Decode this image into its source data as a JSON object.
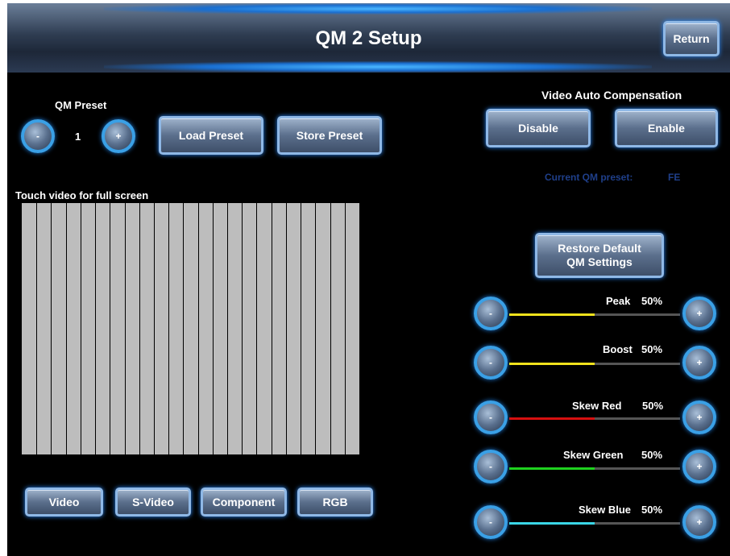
{
  "header": {
    "title": "QM 2 Setup",
    "return_label": "Return"
  },
  "preset": {
    "label": "QM Preset",
    "value": "1",
    "minus": "-",
    "plus": "+",
    "load_label": "Load  Preset",
    "store_label": "Store Preset"
  },
  "video_auto": {
    "label": "Video Auto Compensation",
    "disable_label": "Disable",
    "enable_label": "Enable"
  },
  "current_qm": {
    "label": "Current QM preset:",
    "value": "FE"
  },
  "video": {
    "touch_label": "Touch video for full screen"
  },
  "sources": [
    {
      "label": "Video"
    },
    {
      "label": "S-Video"
    },
    {
      "label": "Component"
    },
    {
      "label": "RGB"
    }
  ],
  "restore": {
    "label_line1": "Restore Default",
    "label_line2": "QM Settings"
  },
  "sliders": [
    {
      "name": "Peak",
      "value": "50%",
      "level": 0.5,
      "color": "#f0e21c"
    },
    {
      "name": "Boost",
      "value": "50%",
      "level": 0.5,
      "color": "#f0e21c"
    },
    {
      "name": "Skew Red",
      "value": "50%",
      "level": 0.5,
      "color": "#d61010"
    },
    {
      "name": "Skew Green",
      "value": "50%",
      "level": 0.5,
      "color": "#1fd11f"
    },
    {
      "name": "Skew Blue",
      "value": "50%",
      "level": 0.5,
      "color": "#3ad6e6"
    }
  ],
  "stepper": {
    "minus": "-",
    "plus": "+"
  }
}
